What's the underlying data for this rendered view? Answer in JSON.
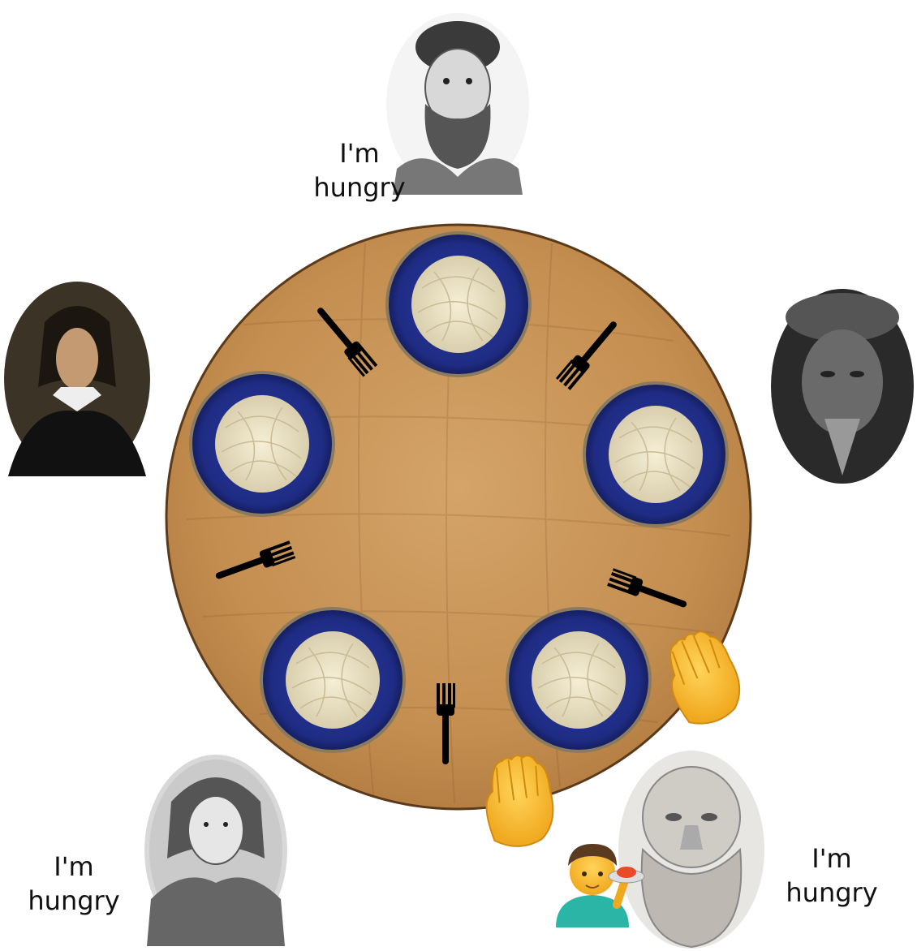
{
  "diagram": {
    "philosophers": [
      {
        "name": "plato-portrait",
        "status_line1": "I'm",
        "status_line2": "hungry"
      },
      {
        "name": "confucius-portrait",
        "status_line1": "",
        "status_line2": ""
      },
      {
        "name": "socrates-portrait",
        "status_line1": "I'm",
        "status_line2": "hungry"
      },
      {
        "name": "voltaire-portrait",
        "status_line1": "I'm",
        "status_line2": "hungry"
      },
      {
        "name": "descartes-portrait",
        "status_line1": "",
        "status_line2": ""
      }
    ],
    "plates": 5,
    "forks": 5,
    "waiter_icon": "waiter-serving-spaghetti-icon",
    "hand_icon": "raised-hand-icon",
    "colors": {
      "table": "#c89455",
      "table_edge": "#5a3a1a",
      "plate": "#1f2f8c",
      "pasta": "#efe6c8",
      "fork": "#000000",
      "hand": "#f7b928"
    }
  }
}
